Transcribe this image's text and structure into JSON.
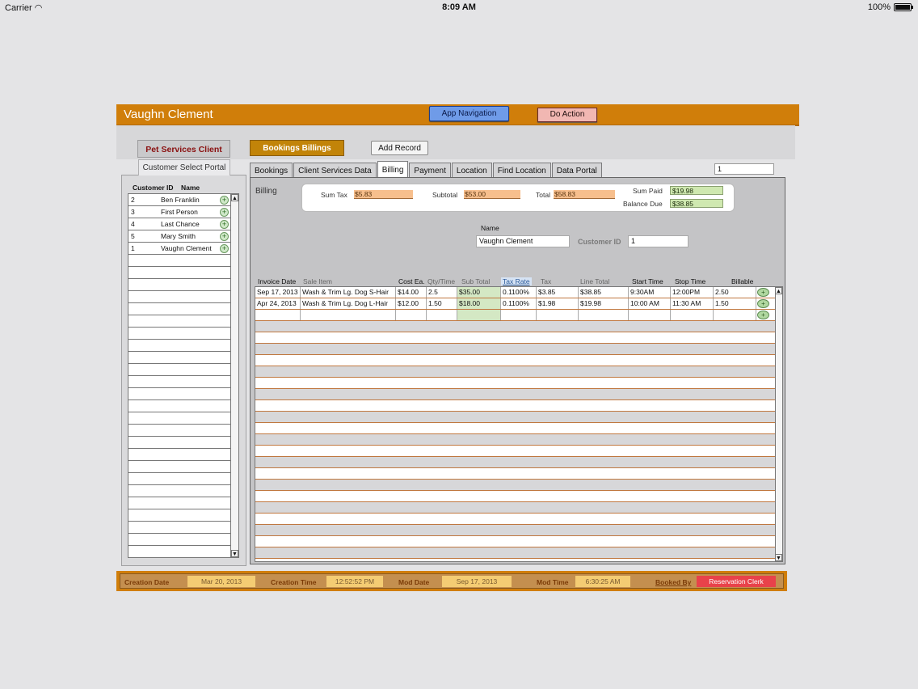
{
  "status_bar": {
    "carrier": "Carrier",
    "time": "8:09 AM",
    "battery": "100%"
  },
  "header": {
    "title": "Vaughn Clement",
    "nav_button": "App Navigation",
    "action_button": "Do Action"
  },
  "left": {
    "tab_label": "Pet Services Client",
    "portal_label": "Customer Select Portal",
    "col_id": "Customer ID",
    "col_name": "Name",
    "customers": [
      {
        "id": "2",
        "name": "Ben Franklin"
      },
      {
        "id": "3",
        "name": "First Person"
      },
      {
        "id": "4",
        "name": "Last Chance"
      },
      {
        "id": "5",
        "name": "Mary Smith"
      },
      {
        "id": "1",
        "name": "Vaughn Clement"
      }
    ]
  },
  "toolbar": {
    "bookings_billings": "Bookings Billings",
    "add_record": "Add Record"
  },
  "tabs": [
    "Bookings",
    "Client Services Data",
    "Billing",
    "Payment",
    "Location",
    "Find Location",
    "Data Portal"
  ],
  "active_tab": "Billing",
  "record_number": "1",
  "billing": {
    "label": "Billing",
    "sum_tax_label": "Sum Tax",
    "sum_tax": "$5.83",
    "subtotal_label": "Subtotal",
    "subtotal": "$53.00",
    "total_label": "Total",
    "total": "$58.83",
    "sum_paid_label": "Sum Paid",
    "sum_paid": "$19.98",
    "balance_due_label": "Balance Due",
    "balance_due": "$38.85",
    "name_label": "Name",
    "name": "Vaughn Clement",
    "customer_id_label": "Customer ID",
    "customer_id": "1"
  },
  "invoice": {
    "headers": {
      "invoice_date": "Invoice Date",
      "sale_item": "Sale Item",
      "cost_ea": "Cost Ea.",
      "qty_time": "Qty/Time",
      "sub_total": "Sub Total",
      "tax_rate": "Tax Rate",
      "tax": "Tax",
      "line_total": "Line Total",
      "start_time": "Start Time",
      "stop_time": "Stop Time",
      "billable": "Billable"
    },
    "rows": [
      {
        "date": "Sep 17, 2013",
        "item": "Wash & Trim Lg. Dog S-Hair",
        "cost": "$14.00",
        "qty": "2.5",
        "sub": "$35.00",
        "rate": "0.1100%",
        "tax": "$3.85",
        "line": "$38.85",
        "start": "9:30AM",
        "stop": "12:00PM",
        "billable": "2.50"
      },
      {
        "date": "Apr 24, 2013",
        "item": "Wash & Trim Lg. Dog L-Hair",
        "cost": "$12.00",
        "qty": "1.50",
        "sub": "$18.00",
        "rate": "0.1100%",
        "tax": "$1.98",
        "line": "$19.98",
        "start": "10:00 AM",
        "stop": "11:30 AM",
        "billable": "1.50"
      }
    ]
  },
  "footer": {
    "creation_date_label": "Creation Date",
    "creation_date": "Mar 20, 2013",
    "creation_time_label": "Creation Time",
    "creation_time": "12:52:52 PM",
    "mod_date_label": "Mod Date",
    "mod_date": "Sep 17, 2013",
    "mod_time_label": "Mod Time",
    "mod_time": "6:30:25 AM",
    "booked_by_label": "Booked By",
    "booked_by": "Reservation Clerk"
  }
}
